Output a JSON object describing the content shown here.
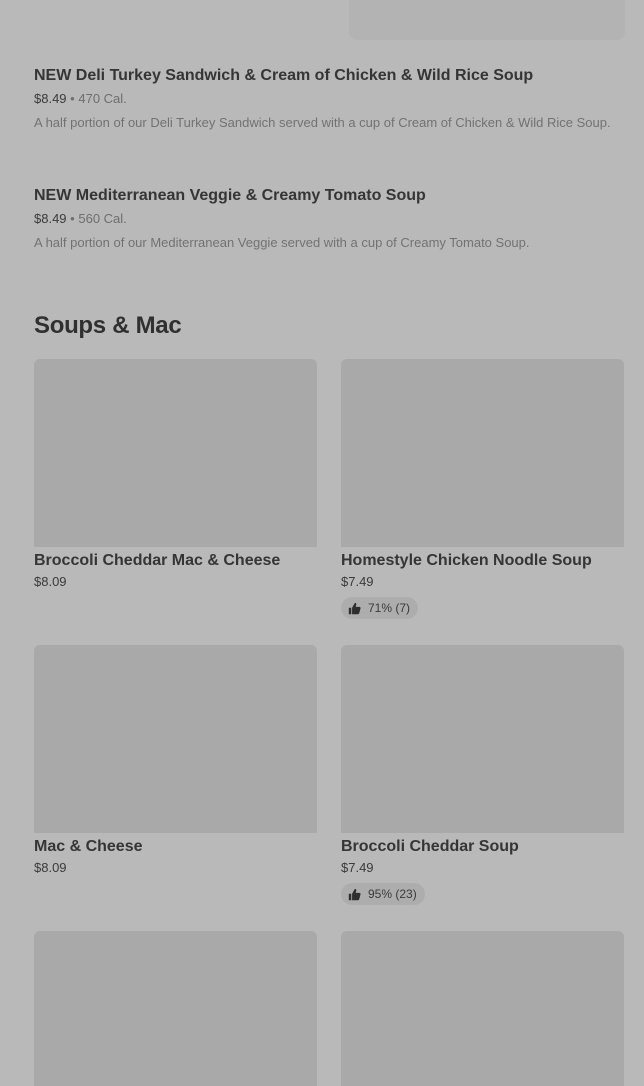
{
  "combos": [
    {
      "title": "NEW Deli Turkey Sandwich & Cream of Chicken & Wild Rice Soup",
      "price": "$8.49",
      "separator": "•",
      "calories": "470 Cal.",
      "description": "A half portion of our Deli Turkey Sandwich served with a cup of Cream of Chicken & Wild Rice Soup."
    },
    {
      "title": "NEW Mediterranean Veggie & Creamy Tomato Soup",
      "price": "$8.49",
      "separator": "•",
      "calories": "560 Cal.",
      "description": "A half portion of our Mediterranean Veggie served with a cup of Creamy Tomato Soup."
    }
  ],
  "section": {
    "title": "Soups & Mac"
  },
  "items": [
    {
      "name": "Broccoli Cheddar Mac & Cheese",
      "price": "$8.09"
    },
    {
      "name": "Homestyle Chicken Noodle Soup",
      "price": "$7.49",
      "rating": "71% (7)"
    },
    {
      "name": "Mac & Cheese",
      "price": "$8.09"
    },
    {
      "name": "Broccoli Cheddar Soup",
      "price": "$7.49",
      "rating": "95% (23)"
    }
  ],
  "icons": {
    "rating": "thumbs-up-icon"
  },
  "colors": {
    "background": "#b9b9b9",
    "image_placeholder": "#a9a9a9",
    "text": "#353535"
  }
}
